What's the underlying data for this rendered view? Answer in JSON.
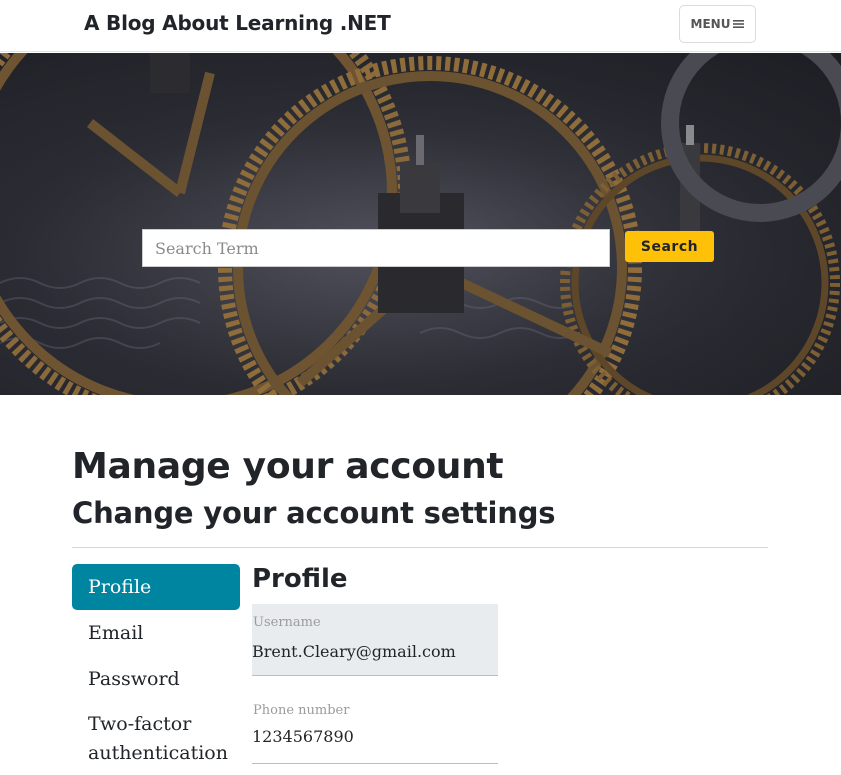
{
  "navbar": {
    "brand": "A Blog About Learning .NET",
    "menu_label": "MENU"
  },
  "hero": {
    "search_placeholder": "Search Term",
    "search_button": "Search"
  },
  "page": {
    "title": "Manage your account",
    "subtitle": "Change your account settings"
  },
  "sidebar": {
    "items": [
      {
        "label": "Profile",
        "active": true
      },
      {
        "label": "Email",
        "active": false
      },
      {
        "label": "Password",
        "active": false
      },
      {
        "label": "Two-factor authentication",
        "active": false
      }
    ]
  },
  "profile": {
    "heading": "Profile",
    "username_label": "Username",
    "username_value": "Brent.Cleary@gmail.com",
    "phone_label": "Phone number",
    "phone_value": "1234567890"
  },
  "colors": {
    "accent": "#0085a1",
    "search_button": "#ffc107"
  },
  "icons": {
    "menu": "hamburger-icon"
  }
}
